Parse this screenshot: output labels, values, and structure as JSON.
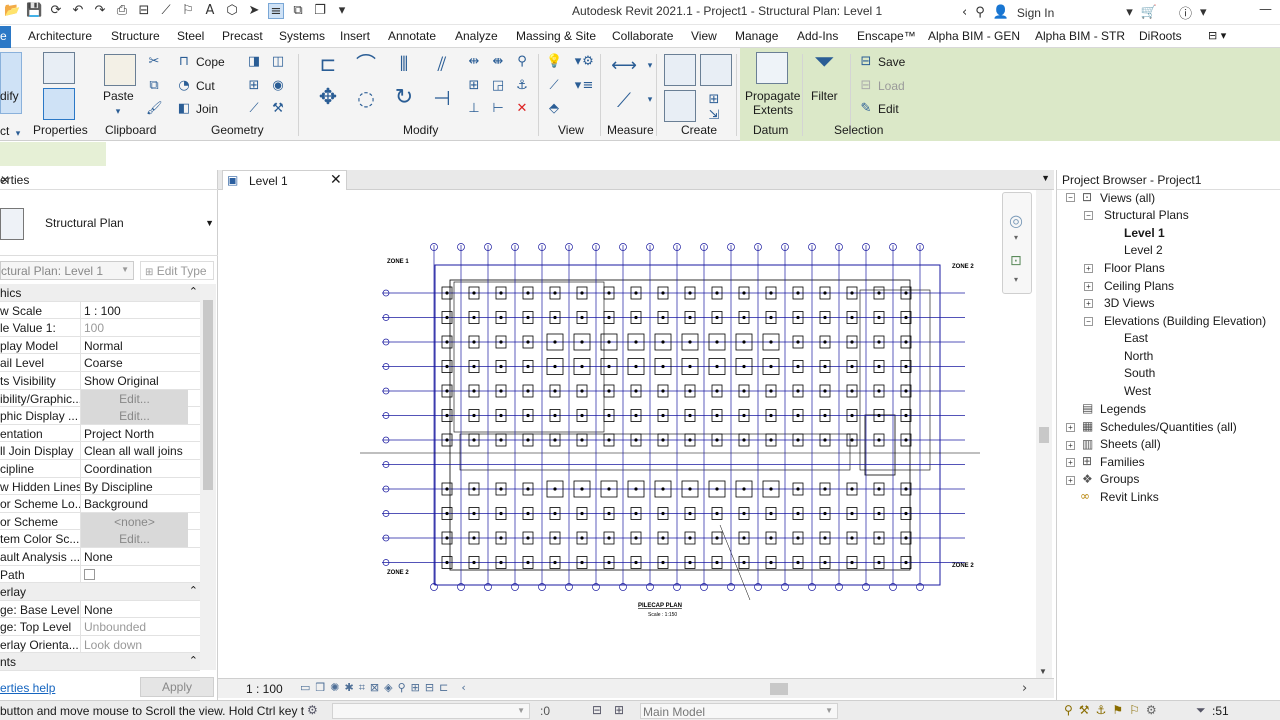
{
  "app": {
    "title": "Autodesk Revit 2021.1 - Project1 - Structural Plan: Level 1",
    "sign_in": "Sign In",
    "help": "?"
  },
  "ribbon": {
    "tabs": [
      {
        "label": "e",
        "active": true
      },
      {
        "label": "Architecture"
      },
      {
        "label": "Structure"
      },
      {
        "label": "Steel"
      },
      {
        "label": "Precast"
      },
      {
        "label": "Systems"
      },
      {
        "label": "Insert"
      },
      {
        "label": "Annotate"
      },
      {
        "label": "Analyze"
      },
      {
        "label": "Massing & Site"
      },
      {
        "label": "Collaborate"
      },
      {
        "label": "View"
      },
      {
        "label": "Manage"
      },
      {
        "label": "Add-Ins"
      },
      {
        "label": "Enscape™"
      },
      {
        "label": "Alpha BIM - GEN"
      },
      {
        "label": "Alpha BIM - STR"
      },
      {
        "label": "DiRoots"
      }
    ],
    "modify_label": "dify",
    "select_label": "ct",
    "properties_label": "Properties",
    "paste_label": "Paste",
    "clipboard_label": "Clipboard",
    "cope_label": "Cope",
    "cut_label": "Cut",
    "join_label": "Join",
    "geometry_label": "Geometry",
    "modify_panel_label": "Modify",
    "view_label": "View",
    "measure_label": "Measure",
    "create_label": "Create",
    "propagate_label_1": "Propagate",
    "propagate_label_2": "Extents",
    "datum_label": "Datum",
    "filter_label": "Filter",
    "save_label": "Save",
    "load_label": "Load",
    "edit_label": "Edit",
    "selection_label": "Selection"
  },
  "properties": {
    "header": "erties",
    "type_name": "Structural Plan",
    "instance": "ctural Plan: Level 1",
    "edit_type": "Edit Type",
    "rows": [
      {
        "group": "hics"
      },
      {
        "k": "w Scale",
        "v": "1 : 100"
      },
      {
        "k": "le Value   1:",
        "v": "100",
        "gray": true
      },
      {
        "k": "play Model",
        "v": "Normal"
      },
      {
        "k": "ail Level",
        "v": "Coarse"
      },
      {
        "k": "ts Visibility",
        "v": "Show Original"
      },
      {
        "k": "ibility/Graphic...",
        "v": "Edit...",
        "btn": true
      },
      {
        "k": "phic Display ...",
        "v": "Edit...",
        "btn": true
      },
      {
        "k": "entation",
        "v": "Project North"
      },
      {
        "k": "ll Join Display",
        "v": "Clean all wall joins"
      },
      {
        "k": "cipline",
        "v": "Coordination"
      },
      {
        "k": "w Hidden Lines",
        "v": "By Discipline"
      },
      {
        "k": "or Scheme Lo...",
        "v": "Background"
      },
      {
        "k": "or Scheme",
        "v": "<none>",
        "btn": true
      },
      {
        "k": "tem Color Sc...",
        "v": "Edit...",
        "btn": true
      },
      {
        "k": "ault Analysis ...",
        "v": "None"
      },
      {
        "k": " Path",
        "v": ""
      },
      {
        "group": "erlay"
      },
      {
        "k": "ge: Base Level",
        "v": "None"
      },
      {
        "k": "ge: Top Level",
        "v": "Unbounded",
        "gray": true
      },
      {
        "k": "erlay Orienta...",
        "v": "Look down",
        "gray": true
      },
      {
        "group": "nts"
      }
    ],
    "help": "erties help",
    "apply": "Apply"
  },
  "view": {
    "tab_label": "Level 1",
    "scale": "1 : 100",
    "plan_title": "PILECAP PLAN",
    "plan_scale": "Scale : 1:150",
    "zone_1": "ZONE 1",
    "zone_2": "ZONE 2"
  },
  "browser": {
    "header": "Project Browser - Project1",
    "views_all": "Views (all)",
    "structural_plans": "Structural Plans",
    "level_1": "Level 1",
    "level_2": "Level 2",
    "floor_plans": "Floor Plans",
    "ceiling_plans": "Ceiling Plans",
    "views_3d": "3D Views",
    "elevations": "Elevations (Building Elevation)",
    "east": "East",
    "north": "North",
    "south": "South",
    "west": "West",
    "legends": "Legends",
    "schedules": "Schedules/Quantities (all)",
    "sheets": "Sheets (all)",
    "families": "Families",
    "groups": "Groups",
    "revit_links": "Revit Links"
  },
  "status": {
    "message": "button and move mouse to Scroll the view. Hold Ctrl key t",
    "zero": ":0",
    "model": "Main Model",
    "filter_count": ":51"
  }
}
